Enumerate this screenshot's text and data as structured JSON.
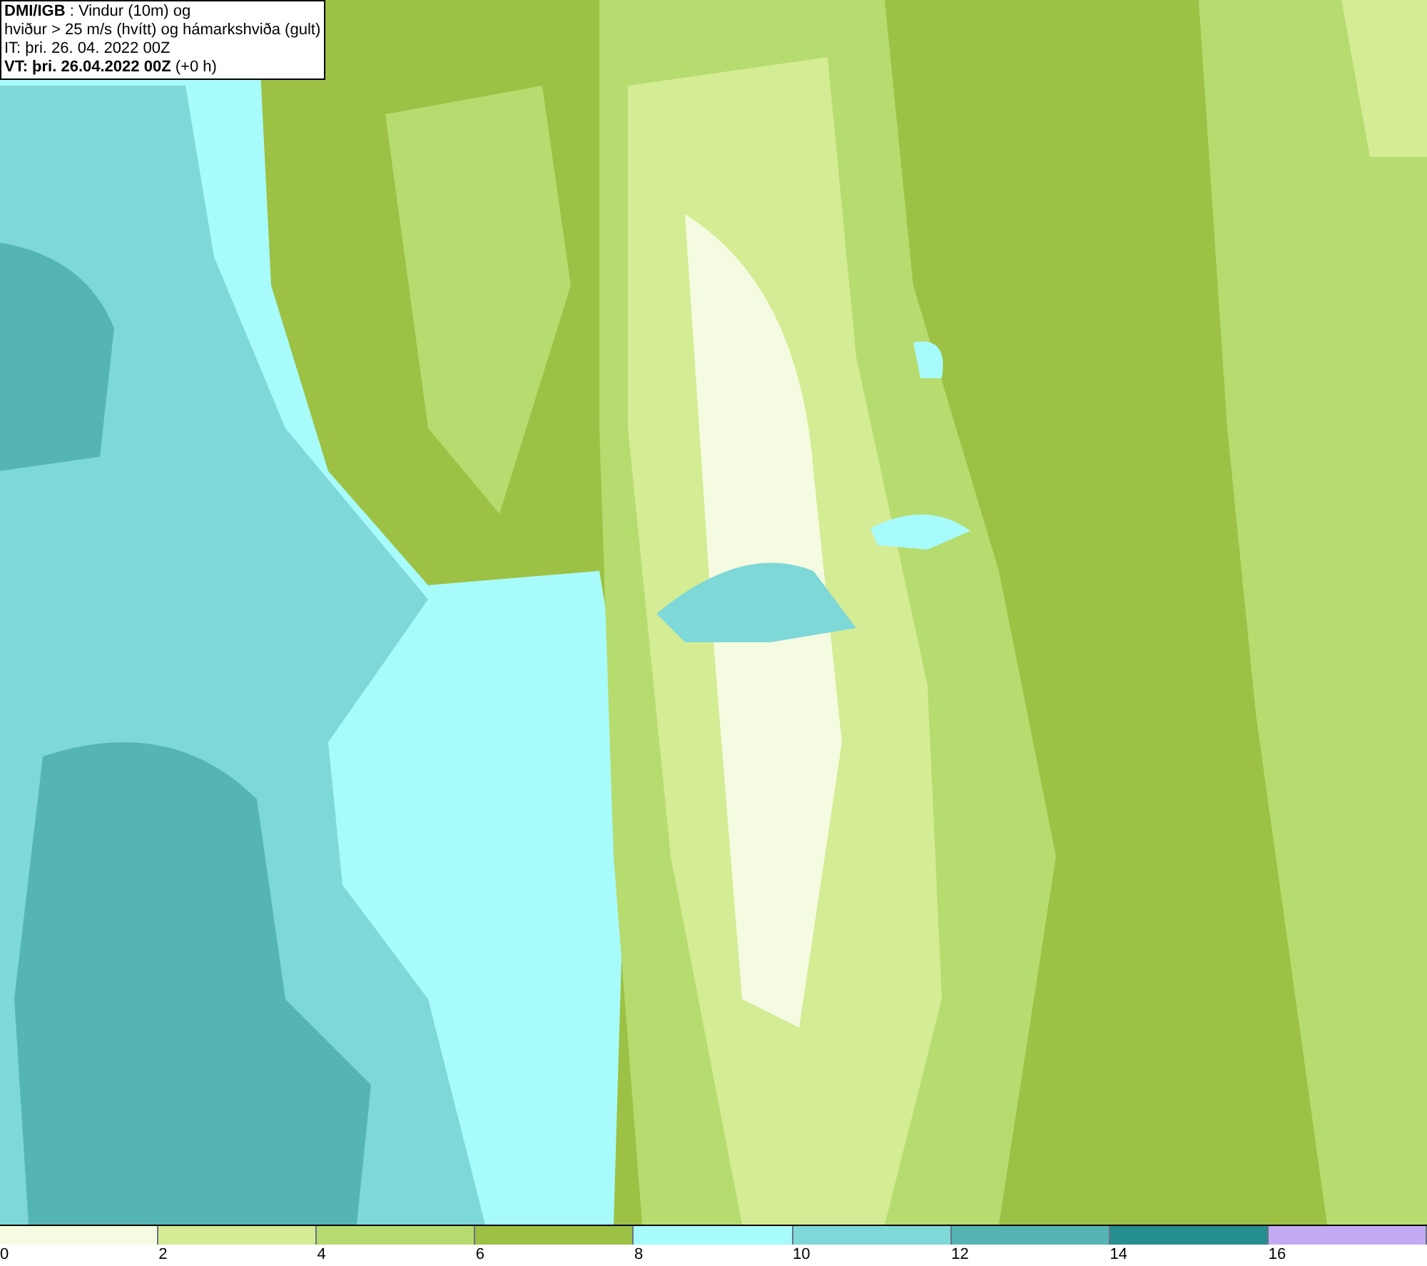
{
  "legend": {
    "lines": [
      "**DMI/IGB** : Vindur (10m) og",
      "hviður > 25 m/s (hvítt) og hámarkshviða (gult)",
      "IT: þri. 26. 04. 2022 00Z",
      "**VT: þri. 26.04.2022 00Z** (+0 h)"
    ]
  },
  "colorbar": {
    "segments": [
      {
        "color": "#f5fbe0"
      },
      {
        "color": "#d4ec94"
      },
      {
        "color": "#b6db6f"
      },
      {
        "color": "#9cc144"
      },
      {
        "color": "#a8fbfb"
      },
      {
        "color": "#7fd8d8"
      },
      {
        "color": "#55b5b5"
      },
      {
        "color": "#258f8f"
      },
      {
        "color": "#c2aaf2"
      }
    ],
    "labels": [
      "0",
      "2",
      "4",
      "6",
      "8",
      "10",
      "12",
      "14",
      "16"
    ]
  }
}
